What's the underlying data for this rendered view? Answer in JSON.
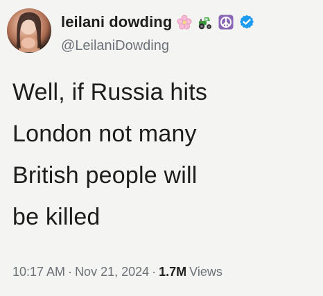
{
  "author": {
    "display_name": "leilani dowding",
    "handle": "@LeilaniDowding",
    "badges": [
      {
        "icon": "cherry-blossom-icon",
        "color": "#f3b6cf"
      },
      {
        "icon": "tractor-icon",
        "color": "#3a8a3a"
      },
      {
        "icon": "peace-symbol-icon",
        "color": "#8d68b8"
      },
      {
        "icon": "verified-badge-icon",
        "color": "#1d9bf0"
      }
    ]
  },
  "tweet": {
    "lines": [
      "Well, if Russia hits",
      "London not many",
      "British people will",
      "be killed"
    ]
  },
  "meta": {
    "time": "10:17 AM",
    "separator_1": "·",
    "date": "Nov 21, 2024",
    "separator_2": "·",
    "views_count": "1.7M",
    "views_label": "Views"
  }
}
